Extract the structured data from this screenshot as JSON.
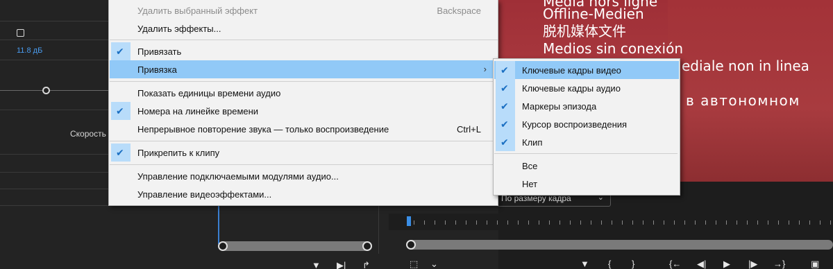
{
  "left_panel": {
    "value": "11.8 дБ",
    "speed_label": "Скорость"
  },
  "context_menu": {
    "items": [
      {
        "label": "Удалить выбранный эффект",
        "shortcut": "Backspace",
        "disabled": true
      },
      {
        "label": "Удалить эффекты..."
      },
      {
        "label": "Привязать",
        "checked": true
      },
      {
        "label": "Привязка",
        "submenu": true,
        "highlighted": true
      },
      {
        "label": "Показать единицы времени аудио"
      },
      {
        "label": "Номера на линейке времени",
        "checked": true
      },
      {
        "label": "Непрерывное повторение звука — только воспроизведение",
        "shortcut": "Ctrl+L"
      },
      {
        "label": "Прикрепить к клипу",
        "checked": true
      },
      {
        "label": "Управление подключаемыми модулями аудио..."
      },
      {
        "label": "Управление видеоэффектами..."
      }
    ]
  },
  "submenu": {
    "items": [
      {
        "label": "Ключевые кадры видео",
        "checked": true,
        "highlighted": true
      },
      {
        "label": "Ключевые кадры аудио",
        "checked": true
      },
      {
        "label": "Маркеры эпизода",
        "checked": true
      },
      {
        "label": "Курсор воспроизведения",
        "checked": true
      },
      {
        "label": "Клип",
        "checked": true
      },
      {
        "label": "Все"
      },
      {
        "label": "Нет"
      }
    ]
  },
  "monitor": {
    "lines": [
      "Media hors ligne",
      "Offline-Medien",
      "脱机媒体文件",
      "Medios sin conexión",
      "ediale non in linea",
      "в автономном"
    ],
    "zoom_select": "По размеру кадра"
  },
  "icons": {
    "check": "✔",
    "submenu_arrow": "›",
    "dropdown": "chevron-down-icon"
  },
  "colors": {
    "menu_highlight": "#91c9f7",
    "check_bg": "#b8dcfa",
    "check_color": "#1a6fc2",
    "monitor_bg": "#a3343a",
    "accent_blue": "#4a9cf0"
  }
}
